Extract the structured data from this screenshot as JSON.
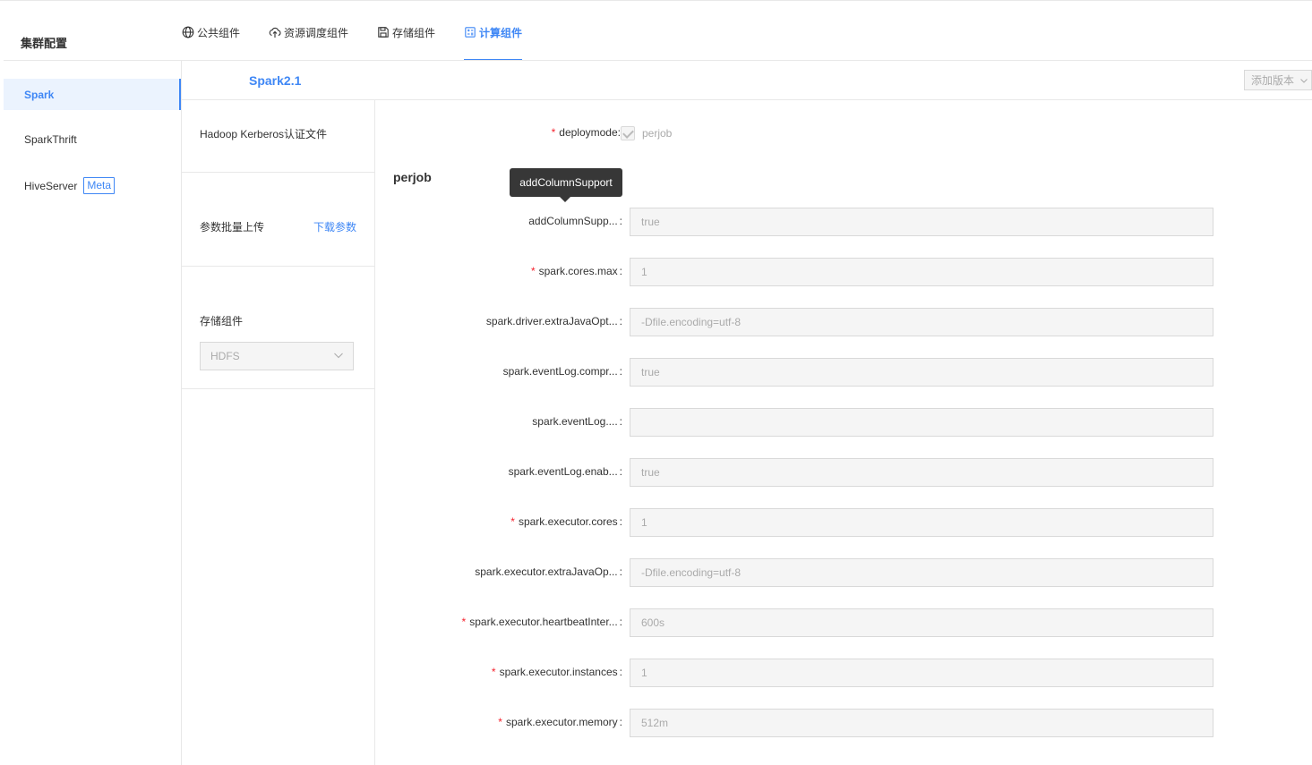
{
  "header": {
    "title": "集群配置",
    "tabs": [
      {
        "label": "公共组件",
        "icon": "globe-icon",
        "active": false
      },
      {
        "label": "资源调度组件",
        "icon": "cloud-upload-icon",
        "active": false
      },
      {
        "label": "存储组件",
        "icon": "save-icon",
        "active": false
      },
      {
        "label": "计算组件",
        "icon": "calculator-icon",
        "active": true
      }
    ]
  },
  "sidebar": {
    "items": [
      {
        "label": "Spark",
        "active": true
      },
      {
        "label": "SparkThrift",
        "active": false
      },
      {
        "label": "HiveServer",
        "active": false,
        "badge": "Meta"
      }
    ]
  },
  "version_bar": {
    "active_version": "Spark2.1",
    "add_version_label": "添加版本"
  },
  "mid_panel": {
    "kerberos_label": "Hadoop Kerberos认证文件",
    "bulk_upload_label": "参数批量上传",
    "download_link": "下载参数",
    "storage_label": "存储组件",
    "storage_value": "HDFS"
  },
  "form": {
    "deploymode": {
      "label": "deploymode",
      "separator": ":",
      "option": "perjob",
      "checked": true,
      "required": true
    },
    "section_title": "perjob",
    "tooltip": "addColumnSupport",
    "fields": [
      {
        "label": "addColumnSupp...",
        "value": "true",
        "required": false
      },
      {
        "label": "spark.cores.max",
        "value": "1",
        "required": true
      },
      {
        "label": "spark.driver.extraJavaOpt...",
        "value": "-Dfile.encoding=utf-8",
        "required": false
      },
      {
        "label": "spark.eventLog.compr...",
        "value": "true",
        "required": false
      },
      {
        "label": "spark.eventLog....",
        "value": "",
        "required": false
      },
      {
        "label": "spark.eventLog.enab...",
        "value": "true",
        "required": false
      },
      {
        "label": "spark.executor.cores",
        "value": "1",
        "required": true
      },
      {
        "label": "spark.executor.extraJavaOp...",
        "value": "-Dfile.encoding=utf-8",
        "required": false
      },
      {
        "label": "spark.executor.heartbeatInter...",
        "value": "600s",
        "required": true
      },
      {
        "label": "spark.executor.instances",
        "value": "1",
        "required": true
      },
      {
        "label": "spark.executor.memory",
        "value": "512m",
        "required": true
      }
    ],
    "separator": ":"
  },
  "colors": {
    "accent": "#3f87f5",
    "required": "#f5222d",
    "disabled_bg": "#f5f5f5",
    "border": "#d9d9d9"
  }
}
